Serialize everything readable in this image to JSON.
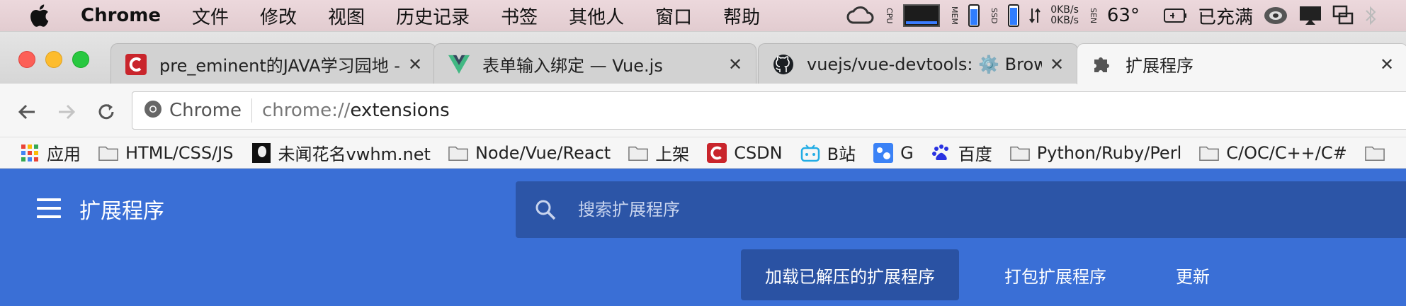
{
  "menubar": {
    "items": [
      "Chrome",
      "文件",
      "修改",
      "视图",
      "历史记录",
      "书签",
      "其他人",
      "窗口",
      "帮助"
    ],
    "status": {
      "cpu_label": "CPU",
      "mem_label": "MEM",
      "ssd_label": "SSD",
      "net_up": "0KB/s",
      "net_down": "0KB/s",
      "sen_label": "SEN",
      "temperature": "63°",
      "battery_text": "已充满"
    }
  },
  "tabs": [
    {
      "title": "pre_eminent的JAVA学习园地 - C",
      "icon": "csdn-icon",
      "close": "✕"
    },
    {
      "title": "表单输入绑定 — Vue.js",
      "icon": "vue-icon",
      "close": "✕"
    },
    {
      "title": "vuejs/vue-devtools: ⚙️ Browse",
      "icon": "github-icon",
      "close": "✕"
    },
    {
      "title": "扩展程序",
      "icon": "puzzle-icon",
      "close": "✕",
      "active": true
    }
  ],
  "toolbar": {
    "chip_label": "Chrome",
    "url_scheme": "chrome://",
    "url_path": "extensions"
  },
  "bookmarks": [
    {
      "label": "应用",
      "icon": "apps-grid-icon"
    },
    {
      "label": "HTML/CSS/JS",
      "icon": "folder-icon"
    },
    {
      "label": "未闻花名vwhm.net",
      "icon": "site-avatar-icon"
    },
    {
      "label": "Node/Vue/React",
      "icon": "folder-icon"
    },
    {
      "label": "上架",
      "icon": "folder-icon"
    },
    {
      "label": "CSDN",
      "icon": "csdn-icon"
    },
    {
      "label": "B站",
      "icon": "bilibili-icon"
    },
    {
      "label": "G",
      "icon": "g-site-icon"
    },
    {
      "label": "百度",
      "icon": "baidu-paw-icon"
    },
    {
      "label": "Python/Ruby/Perl",
      "icon": "folder-icon"
    },
    {
      "label": "C/OC/C++/C#",
      "icon": "folder-icon"
    }
  ],
  "extensions": {
    "title": "扩展程序",
    "search_placeholder": "搜索扩展程序",
    "load_unpacked": "加载已解压的扩展程序",
    "pack": "打包扩展程序",
    "update": "更新"
  },
  "colors": {
    "header_blue": "#3a6fd6",
    "search_bg": "#2c55a7",
    "button_bg": "#2a52a3"
  }
}
